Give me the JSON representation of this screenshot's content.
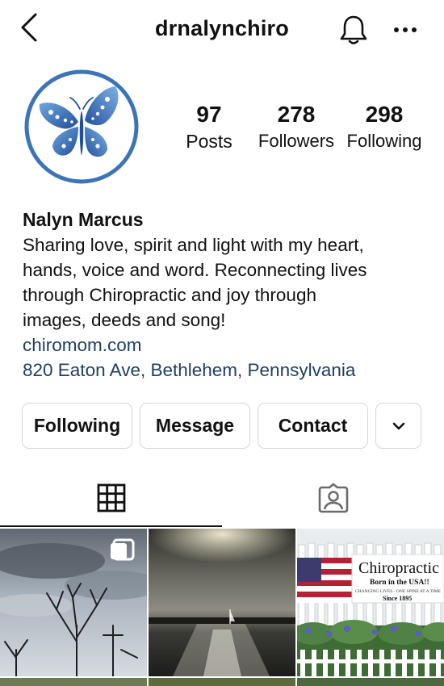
{
  "header": {
    "username": "drnalynchiro",
    "back_icon": "chevron-left-icon",
    "bell_icon": "bell-icon",
    "more_icon": "ellipsis-icon"
  },
  "profile": {
    "avatar_icon": "butterfly-logo",
    "stats": {
      "posts": {
        "count": "97",
        "label": "Posts"
      },
      "followers": {
        "count": "278",
        "label": "Followers"
      },
      "following": {
        "count": "298",
        "label": "Following"
      }
    },
    "name": "Nalyn Marcus",
    "bio_lines": [
      "Sharing love, spirit and light with my heart,",
      "hands, voice and word. Reconnecting lives",
      "through Chiropractic and joy through",
      "images, deeds and song!"
    ],
    "website": "chiromom.com",
    "address": "820 Eaton Ave, Bethlehem, Pennsylvania"
  },
  "actions": {
    "following": "Following",
    "message": "Message",
    "contact": "Contact",
    "more_icon": "chevron-down-icon"
  },
  "tabs": {
    "grid_icon": "grid-icon",
    "tagged_icon": "tagged-icon",
    "active": "grid"
  },
  "posts": {
    "sign_title": "Chiropractic",
    "sign_line1": "Born in the USA!!",
    "sign_line2": "CHANGING LIVES - ONE SPINE AT A TIME",
    "sign_line3": "Since 1895"
  },
  "colors": {
    "link": "#1e3f66",
    "avatar_ring": "#3d74b8",
    "border": "#d6d6d6"
  }
}
